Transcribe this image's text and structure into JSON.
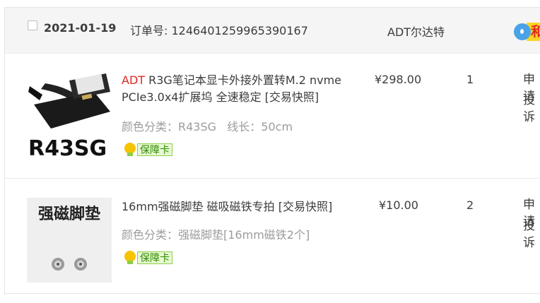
{
  "order": {
    "date": "2021-01-19",
    "order_no_text": "订单号: 1246401259965390167",
    "shop": "ADT尔达特",
    "wang_tag": "和"
  },
  "items": [
    {
      "brand": "ADT",
      "title_rest": " R3G笔记本显卡外接外置转M.2 nvme PCIe3.0x4扩展坞 全速稳定 [交易快照]",
      "attr": "颜色分类：R43SG   线长：50cm",
      "badge": "保障卡",
      "price": "¥298.00",
      "qty": "1",
      "act1": "申请",
      "act2": "投诉",
      "img_text": "R43SG"
    },
    {
      "brand": "",
      "title_rest": "16mm强磁脚垫 磁吸磁铁专拍 [交易快照]",
      "attr": "颜色分类：强磁脚垫[16mm磁铁2个]",
      "badge": "保障卡",
      "price": "¥10.00",
      "qty": "2",
      "act1": "申请",
      "act2": "投诉",
      "img_text": "强磁脚垫"
    }
  ]
}
